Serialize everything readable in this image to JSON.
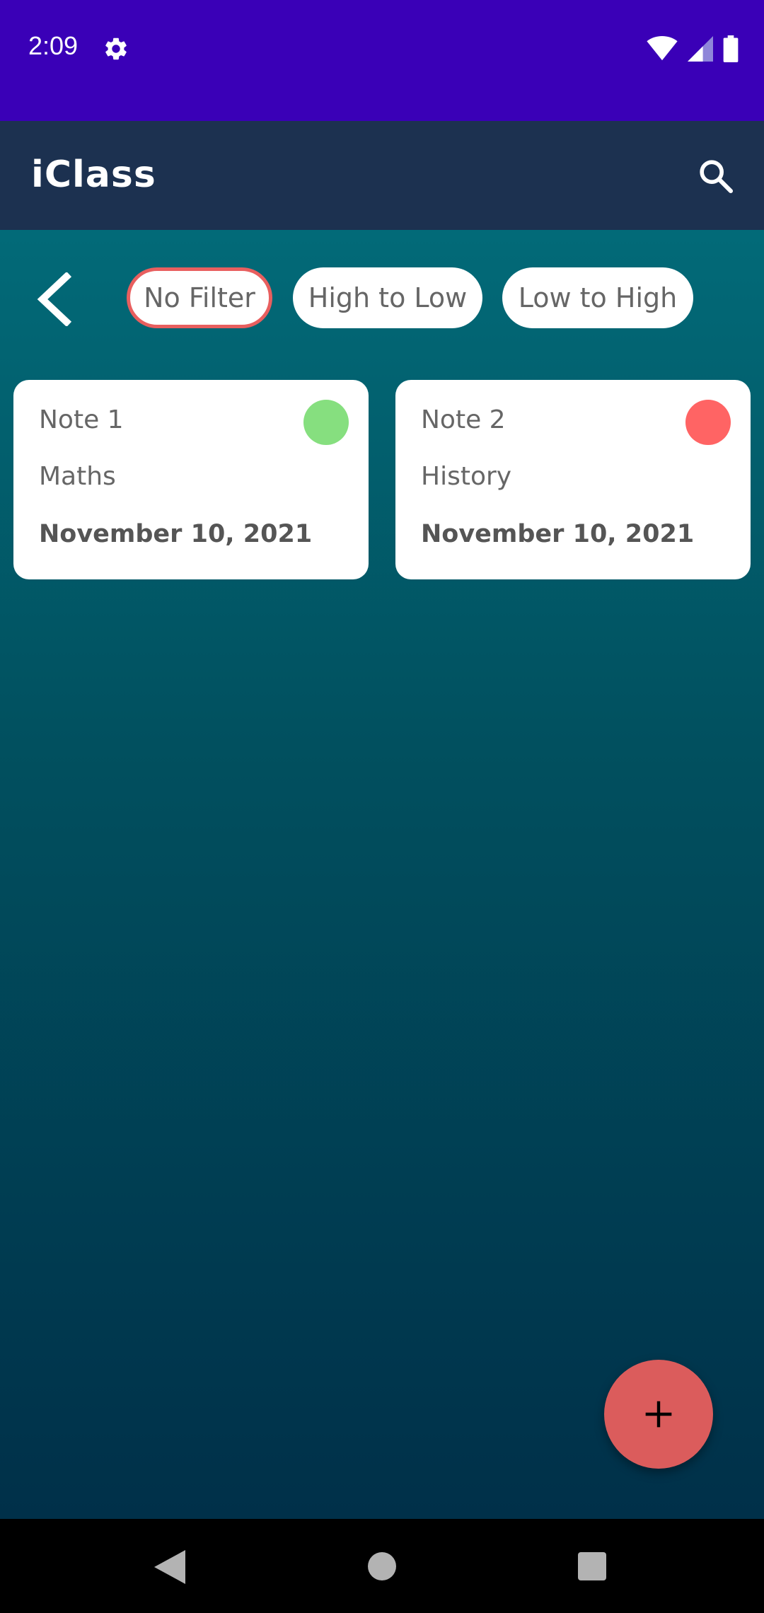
{
  "status_bar": {
    "time": "2:09",
    "icons": [
      "gear-icon",
      "wifi-icon",
      "signal-icon",
      "battery-icon"
    ]
  },
  "app_bar": {
    "title": "iClass",
    "search_icon": "search-icon"
  },
  "filters": {
    "back_icon": "chevron-left-icon",
    "chips": [
      {
        "label": "No Filter",
        "selected": true
      },
      {
        "label": "High to Low",
        "selected": false
      },
      {
        "label": "Low to High",
        "selected": false
      }
    ]
  },
  "notes": [
    {
      "title": "Note 1",
      "subject": "Maths",
      "date": "November 10, 2021",
      "priority_color": "#86df7f"
    },
    {
      "title": "Note 2",
      "subject": "History",
      "date": "November 10, 2021",
      "priority_color": "#ff6464"
    }
  ],
  "fab": {
    "icon": "plus-icon",
    "color": "#db5c5c"
  },
  "colors": {
    "status_bar": "#3a00b7",
    "app_bar": "#1c3150",
    "background_top": "#026a78",
    "background_bottom": "#003049",
    "chip_selected_border": "#e85f5f"
  },
  "nav_bar": {
    "icons": [
      "nav-back-icon",
      "nav-home-icon",
      "nav-recents-icon"
    ]
  }
}
